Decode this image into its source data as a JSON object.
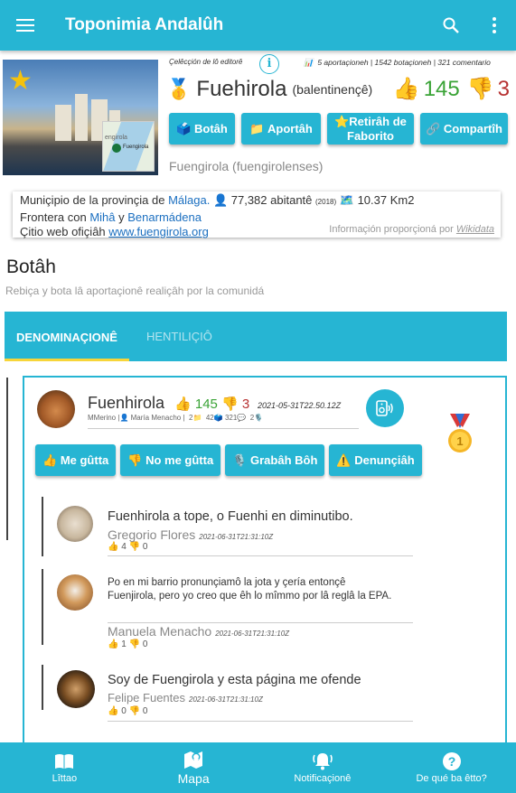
{
  "appbar": {
    "title": "Toponimia Andalûh",
    "menu_icon": "hamburger-menu-icon",
    "search_icon": "search-icon",
    "more_icon": "more-vert-icon"
  },
  "place": {
    "selection_label": "Çelêcçión de lô editorê",
    "stats": "5 aportaçioneh | 1542 botaçioneh | 321 comentario",
    "name": "Fuehirola",
    "lang": "(balentinençê)",
    "votes_up": "145",
    "votes_down": "3",
    "demonym": "Fuengirola (fuengirolenses)",
    "map_label": "Fuengirola",
    "map_label2": "engirola"
  },
  "actions": {
    "vote": "Botâh",
    "contribute": "Aportâh",
    "unfavorite_line1": "⭐Retirâh de",
    "unfavorite_line2": "Faborito",
    "share": "Compartîh"
  },
  "info": {
    "line1_prefix": "Muniçipio de la provinçia de",
    "province": "Málaga.",
    "population": "77,382 abitantê",
    "population_year": "(2018)",
    "area": "10.37 Km2",
    "line2_prefix": "Frontera con",
    "neighbor1": "Mihâ",
    "and": "y",
    "neighbor2": "Benarmádena",
    "line3_prefix": "Çitio web ofiçiâh",
    "website": "www.fuengirola.org",
    "credit_prefix": "Informaçión proporçioná por",
    "credit_source": "Wikidata"
  },
  "section": {
    "title": "Botâh",
    "subtitle": "Rebiça y bota lâ aportaçionê realiçâh por la comunidá"
  },
  "tabs": [
    {
      "label": "DENOMINAÇIONÊ"
    },
    {
      "label": "HENTILIÇIÔ"
    }
  ],
  "entry": {
    "name": "Fuenhirola",
    "votes_up": "145",
    "votes_down": "3",
    "date": "2021-05-31T22.50.12Z",
    "meta_user": "MMerino",
    "meta_author": "María Menacho",
    "meta_contrib": "2",
    "meta_votes": "42",
    "meta_comments": "321",
    "meta_audio": "2",
    "like": "Me gûtta",
    "dislike": "No me gûtta",
    "record": "Grabâh Bôh",
    "report": "Denunçiâh"
  },
  "comments": [
    {
      "text": "Fuenhirola a tope, o Fuenhi en diminutibo.",
      "author": "Gregorio Flores",
      "date": "2021-06-31T21:31:10Z",
      "up": "4",
      "down": "0"
    },
    {
      "text": "Po en mi barrio pronunçiamô la jota y çería entonçê Fuenjirola, pero yo creo que êh lo mîmmo por lâ reglâ la EPA.",
      "author": "Manuela Menacho",
      "date": "2021-06-31T21:31:10Z",
      "up": "1",
      "down": "0"
    },
    {
      "text": "Soy de Fuengirola y esta página me ofende",
      "author": "Felipe Fuentes",
      "date": "2021-06-31T21:31:10Z",
      "up": "0",
      "down": "0"
    }
  ],
  "bottomnav": [
    {
      "label": "Lîttao",
      "icon": "book-icon"
    },
    {
      "label": "Mapa",
      "icon": "map-icon"
    },
    {
      "label": "Notificaçionê",
      "icon": "bell-icon"
    },
    {
      "label": "De qué ba êtto?",
      "icon": "help-icon"
    }
  ],
  "colors": {
    "primary": "#26b5d3",
    "up": "#3aa336",
    "down": "#b73232",
    "indicator": "#f7d53a"
  }
}
